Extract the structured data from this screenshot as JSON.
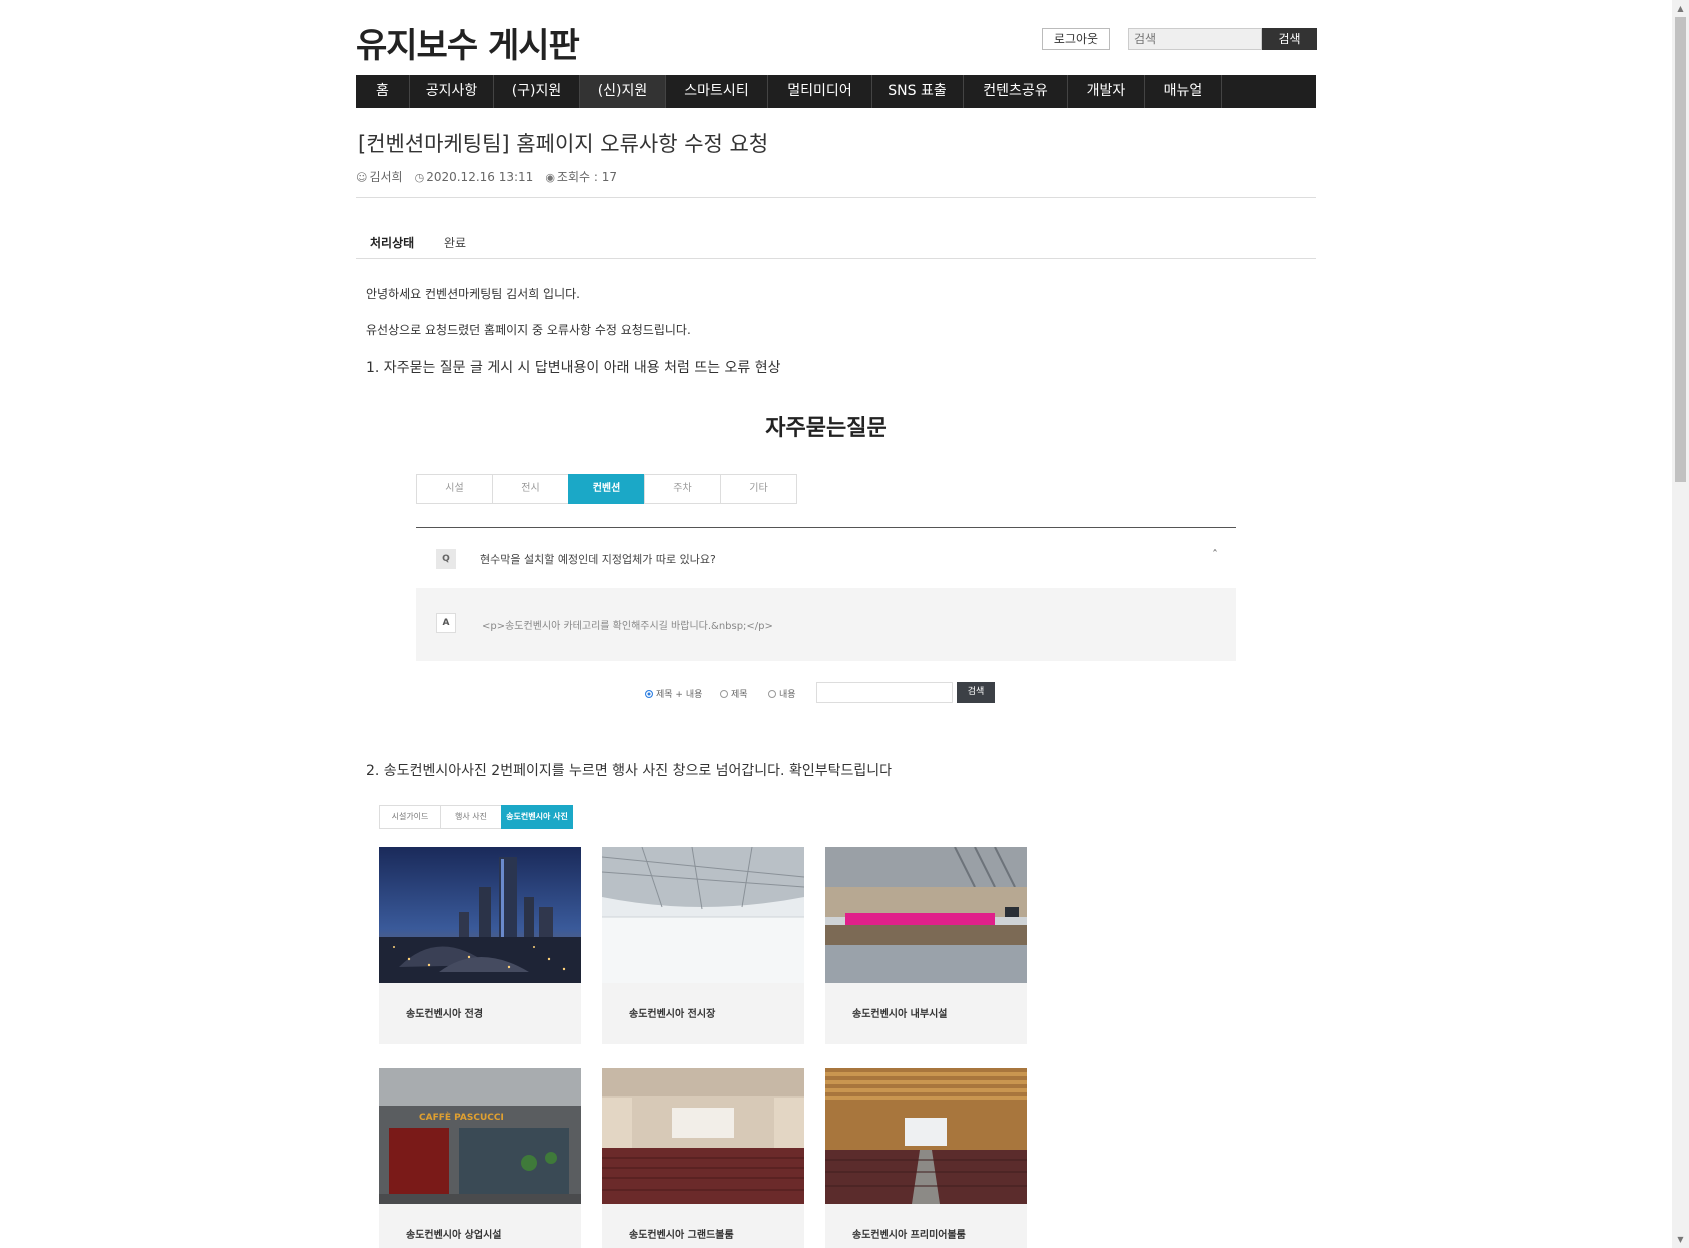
{
  "header": {
    "site_title": "유지보수 게시판",
    "logout_label": "로그아웃",
    "search_placeholder": "검색",
    "search_label": "검색"
  },
  "nav": [
    {
      "label": "홈"
    },
    {
      "label": "공지사항"
    },
    {
      "label": "(구)지원"
    },
    {
      "label": "(신)지원",
      "selected": true
    },
    {
      "label": "스마트시티"
    },
    {
      "label": "멀티미디어"
    },
    {
      "label": "SNS 표출"
    },
    {
      "label": "컨텐츠공유"
    },
    {
      "label": "개발자"
    },
    {
      "label": "매뉴얼"
    }
  ],
  "post": {
    "title": "[컨벤션마케팅팀] 홈페이지 오류사항 수정 요청",
    "author": "김서희",
    "datetime": "2020.12.16 13:11",
    "views": "조회수 : 17",
    "status_key": "처리상태",
    "status_value": "완료",
    "greeting": "안녕하세요 컨벤션마케팅팀 김서희 입니다.",
    "intro": "유선상으로 요청드렸던 홈페이지 중 오류사항 수정 요청드립니다.",
    "item1": "1. 자주묻는 질문 글 게시 시 답변내용이 아래 내용 처럼 뜨는 오류 현상",
    "item2": "2. 송도컨벤시아사진 2번페이지를 누르면 행사 사진 창으로 넘어갑니다. 확인부탁드립니다"
  },
  "faq_shot": {
    "title": "자주묻는질문",
    "tabs": [
      "시설",
      "전시",
      "컨벤션",
      "주차",
      "기타"
    ],
    "active_tab": "컨벤션",
    "q_mark": "Q",
    "question": "현수막을 설치할 예정인데 지정업체가 따로 있나요?",
    "a_mark": "A",
    "answer": "<p>송도컨벤시아 카테고리를 확인해주시길 바랍니다.&nbsp;</p>",
    "radio": [
      "제목 + 내용",
      "제목",
      "내용"
    ],
    "search_label": "검색",
    "accent": "#1ba8c7"
  },
  "gallery_shot": {
    "tabs": [
      "시설가이드",
      "행사 사진",
      "송도컨벤시아 사진"
    ],
    "active_tab": "송도컨벤시아 사진",
    "cards": [
      {
        "caption": "송도컨벤시아 전경"
      },
      {
        "caption": "송도컨벤시아 전시장"
      },
      {
        "caption": "송도컨벤시아 내부시설"
      },
      {
        "caption": "송도컨벤시아 상업시설"
      },
      {
        "caption": "송도컨벤시아 그랜드볼룸"
      },
      {
        "caption": "송도컨벤시아 프리미어볼룸"
      }
    ]
  }
}
